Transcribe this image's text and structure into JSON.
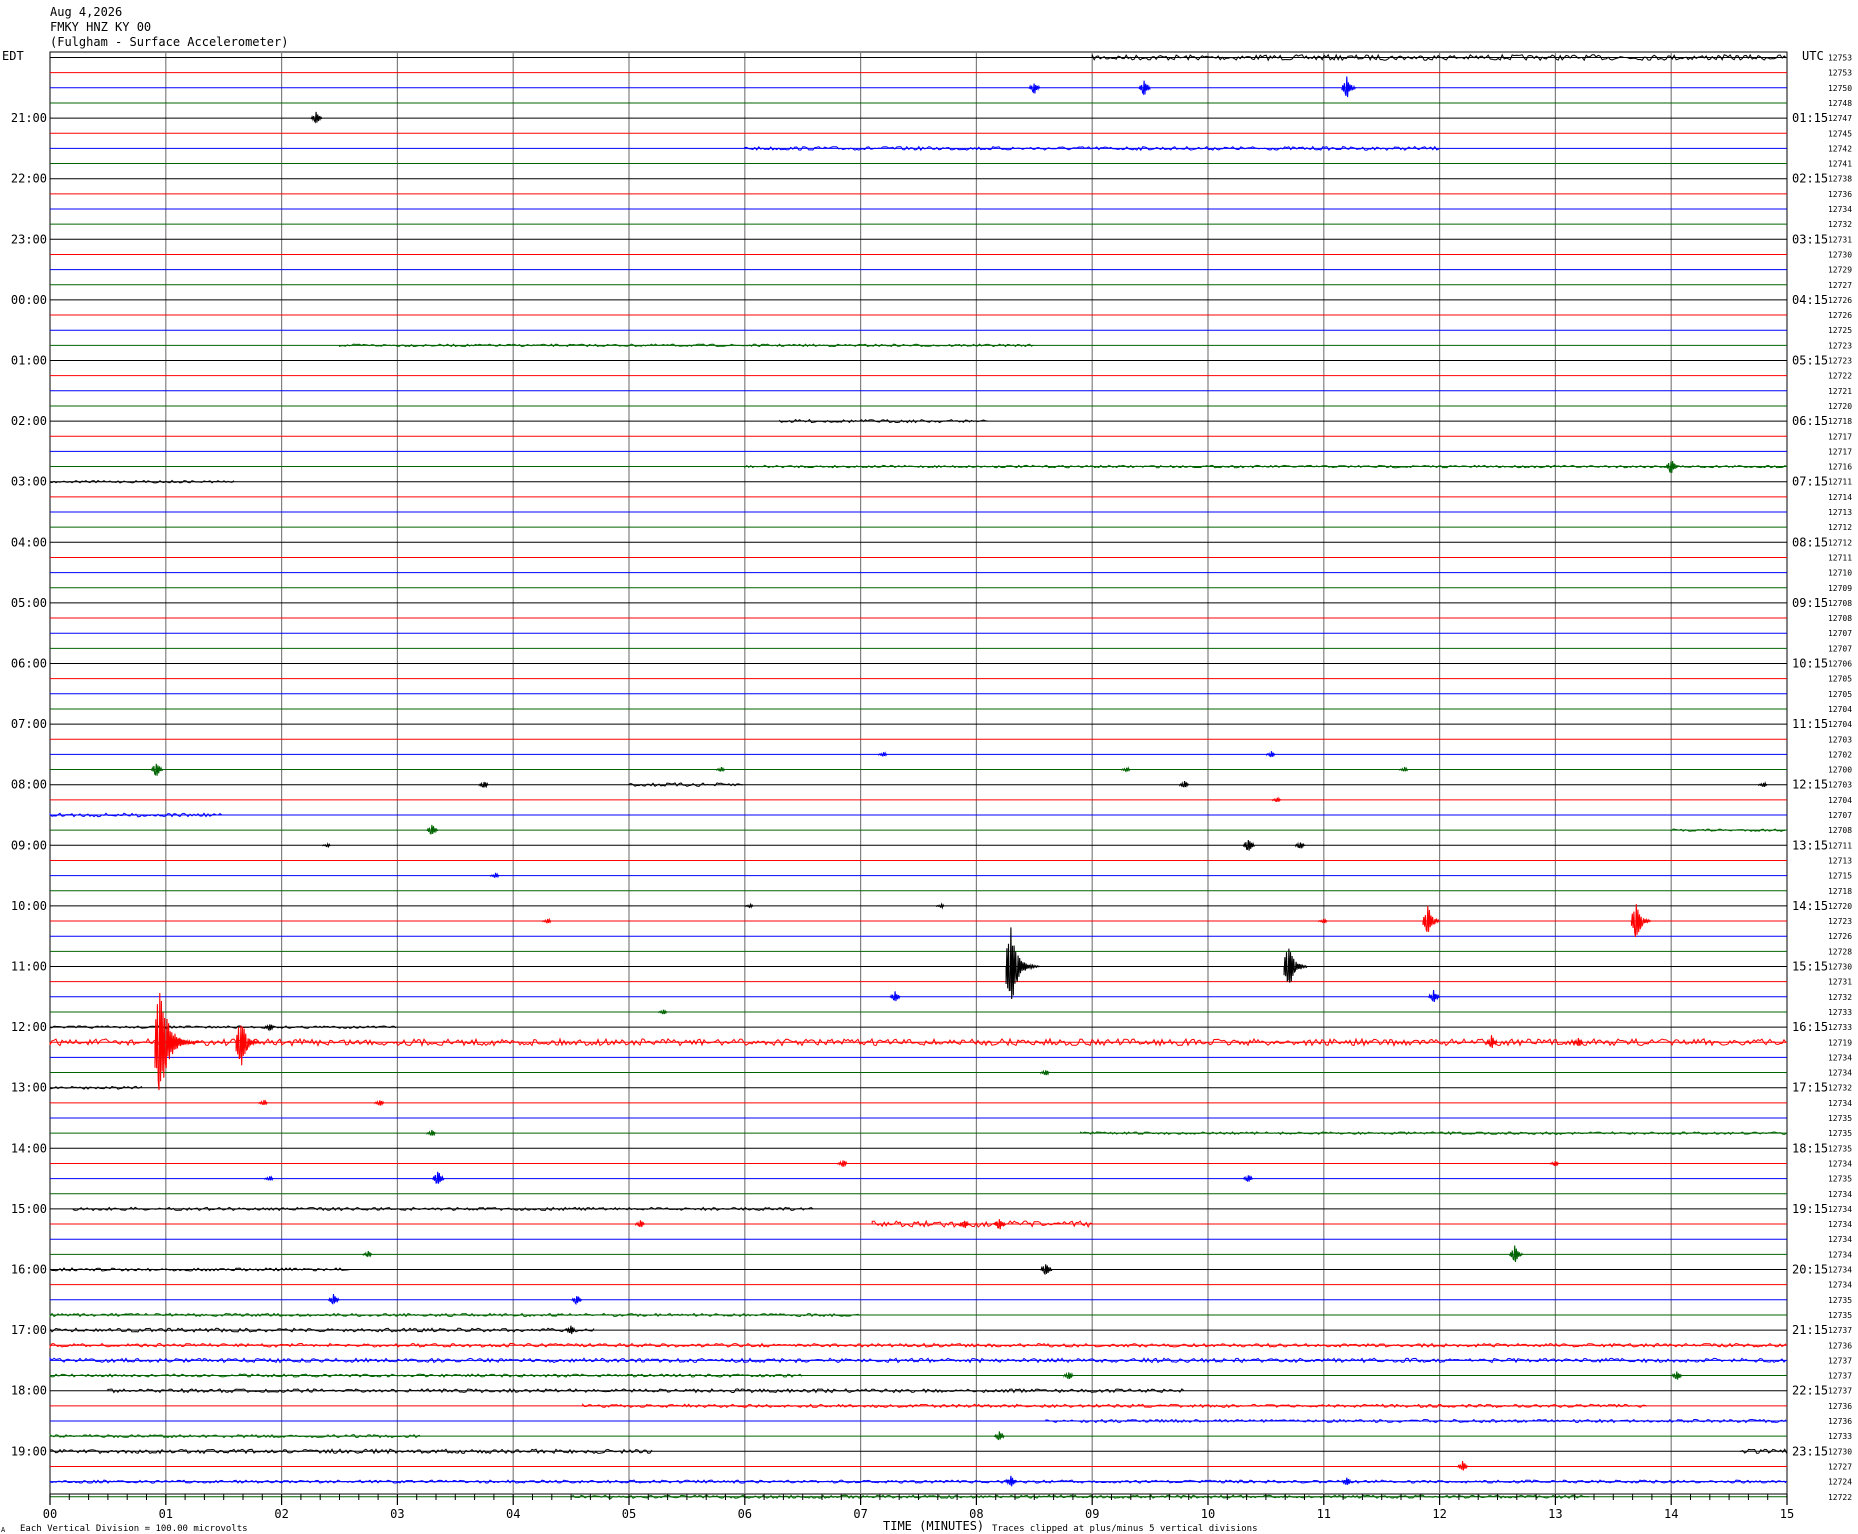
{
  "header": {
    "date": "Aug 4,2026",
    "station": "FMKY HNZ KY 00",
    "description": "(Fulgham - Surface Accelerometer)"
  },
  "footer": {
    "division_note": "Each Vertical Division =  100.00 microvolts",
    "clip_note": "Traces clipped at plus/minus 5 vertical divisions",
    "corner_mark": "A"
  },
  "chart_data": {
    "type": "line",
    "title": "FMKY HNZ KY 00",
    "xlabel": "TIME (MINUTES)",
    "ylabel_left": "EDT",
    "ylabel_right": "UTC",
    "xlim": [
      0,
      15
    ],
    "x_ticks": [
      "00",
      "01",
      "02",
      "03",
      "04",
      "05",
      "06",
      "07",
      "08",
      "09",
      "10",
      "11",
      "12",
      "13",
      "14",
      "15"
    ],
    "grid": true,
    "trace_count": 96,
    "trace_minutes": 15,
    "series_colors": [
      "#000000",
      "#ff0000",
      "#0000ff",
      "#006400"
    ],
    "grid_color": "#808080",
    "left_hour_labels": [
      "21:00",
      "22:00",
      "23:00",
      "00:00",
      "01:00",
      "02:00",
      "03:00",
      "04:00",
      "05:00",
      "06:00",
      "07:00",
      "08:00",
      "09:00",
      "10:00",
      "11:00",
      "12:00",
      "13:00",
      "14:00",
      "15:00",
      "16:00",
      "17:00",
      "18:00",
      "19:00"
    ],
    "right_hour_labels": [
      "01:15",
      "02:15",
      "03:15",
      "04:15",
      "05:15",
      "06:15",
      "07:15",
      "08:15",
      "09:15",
      "10:15",
      "11:15",
      "12:15",
      "13:15",
      "14:15",
      "15:15",
      "16:15",
      "17:15",
      "18:15",
      "19:15",
      "20:15",
      "21:15",
      "22:15",
      "23:15"
    ],
    "first_hour_trace_index": 4,
    "trace_values": [
      "12753",
      "12753",
      "12750",
      "12748",
      "12747",
      "12745",
      "12742",
      "12741",
      "12738",
      "12736",
      "12734",
      "12732",
      "12731",
      "12730",
      "12729",
      "12727",
      "12726",
      "12726",
      "12725",
      "12723",
      "12723",
      "12722",
      "12721",
      "12720",
      "12718",
      "12717",
      "12717",
      "12716",
      "12711",
      "12714",
      "12713",
      "12712",
      "12712",
      "12711",
      "12710",
      "12709",
      "12708",
      "12708",
      "12707",
      "12707",
      "12706",
      "12705",
      "12705",
      "12704",
      "12704",
      "12703",
      "12702",
      "12700",
      "12703",
      "12704",
      "12707",
      "12708",
      "12711",
      "12713",
      "12715",
      "12718",
      "12720",
      "12723",
      "12726",
      "12728",
      "12730",
      "12731",
      "12732",
      "12733",
      "12733",
      "12719",
      "12734",
      "12734",
      "12732",
      "12734",
      "12735",
      "12735",
      "12735",
      "12734",
      "12735",
      "12734",
      "12734",
      "12734",
      "12734",
      "12734",
      "12734",
      "12734",
      "12735",
      "12735",
      "12737",
      "12736",
      "12737",
      "12737",
      "12737",
      "12736",
      "12736",
      "12733",
      "12730",
      "12727",
      "12724",
      "12722"
    ],
    "events": [
      {
        "trace": 2,
        "minute": 8.5,
        "amp": 0.5
      },
      {
        "trace": 2,
        "minute": 9.45,
        "amp": 0.6
      },
      {
        "trace": 2,
        "minute": 11.2,
        "amp": 0.8
      },
      {
        "trace": 4,
        "minute": 2.3,
        "amp": 0.45
      },
      {
        "trace": 27,
        "minute": 14.0,
        "amp": 0.6
      },
      {
        "trace": 46,
        "minute": 7.2,
        "amp": 0.2
      },
      {
        "trace": 46,
        "minute": 10.55,
        "amp": 0.25
      },
      {
        "trace": 47,
        "minute": 0.92,
        "amp": 0.6
      },
      {
        "trace": 47,
        "minute": 5.8,
        "amp": 0.2
      },
      {
        "trace": 47,
        "minute": 9.3,
        "amp": 0.2
      },
      {
        "trace": 47,
        "minute": 11.7,
        "amp": 0.2
      },
      {
        "trace": 48,
        "minute": 3.75,
        "amp": 0.3
      },
      {
        "trace": 48,
        "minute": 9.8,
        "amp": 0.3
      },
      {
        "trace": 48,
        "minute": 14.8,
        "amp": 0.2
      },
      {
        "trace": 49,
        "minute": 10.6,
        "amp": 0.2
      },
      {
        "trace": 51,
        "minute": 3.3,
        "amp": 0.5
      },
      {
        "trace": 52,
        "minute": 2.4,
        "amp": 0.15
      },
      {
        "trace": 52,
        "minute": 10.35,
        "amp": 0.55
      },
      {
        "trace": 52,
        "minute": 10.8,
        "amp": 0.3
      },
      {
        "trace": 54,
        "minute": 3.85,
        "amp": 0.2
      },
      {
        "trace": 56,
        "minute": 6.05,
        "amp": 0.15
      },
      {
        "trace": 56,
        "minute": 7.7,
        "amp": 0.15
      },
      {
        "trace": 57,
        "minute": 4.3,
        "amp": 0.2
      },
      {
        "trace": 57,
        "minute": 11.0,
        "amp": 0.2
      },
      {
        "trace": 57,
        "minute": 11.9,
        "amp": 1.1
      },
      {
        "trace": 57,
        "minute": 13.7,
        "amp": 1.4
      },
      {
        "trace": 60,
        "minute": 8.3,
        "amp": 2.8
      },
      {
        "trace": 60,
        "minute": 10.7,
        "amp": 1.8
      },
      {
        "trace": 62,
        "minute": 7.3,
        "amp": 0.4
      },
      {
        "trace": 62,
        "minute": 11.95,
        "amp": 0.5
      },
      {
        "trace": 63,
        "minute": 5.3,
        "amp": 0.2
      },
      {
        "trace": 64,
        "minute": 1.9,
        "amp": 0.3
      },
      {
        "trace": 65,
        "minute": 0.95,
        "amp": 3.9
      },
      {
        "trace": 65,
        "minute": 1.65,
        "amp": 1.8
      },
      {
        "trace": 65,
        "minute": 12.45,
        "amp": 0.5
      },
      {
        "trace": 65,
        "minute": 13.2,
        "amp": 0.35
      },
      {
        "trace": 67,
        "minute": 8.6,
        "amp": 0.25
      },
      {
        "trace": 69,
        "minute": 1.85,
        "amp": 0.25
      },
      {
        "trace": 69,
        "minute": 2.85,
        "amp": 0.3
      },
      {
        "trace": 71,
        "minute": 3.3,
        "amp": 0.25
      },
      {
        "trace": 73,
        "minute": 6.85,
        "amp": 0.3
      },
      {
        "trace": 73,
        "minute": 13.0,
        "amp": 0.25
      },
      {
        "trace": 74,
        "minute": 1.9,
        "amp": 0.2
      },
      {
        "trace": 74,
        "minute": 3.35,
        "amp": 0.6
      },
      {
        "trace": 74,
        "minute": 10.35,
        "amp": 0.35
      },
      {
        "trace": 77,
        "minute": 5.1,
        "amp": 0.3
      },
      {
        "trace": 77,
        "minute": 8.2,
        "amp": 0.5
      },
      {
        "trace": 77,
        "minute": 7.9,
        "amp": 0.35
      },
      {
        "trace": 79,
        "minute": 2.75,
        "amp": 0.25
      },
      {
        "trace": 79,
        "minute": 12.65,
        "amp": 0.7
      },
      {
        "trace": 80,
        "minute": 8.6,
        "amp": 0.55
      },
      {
        "trace": 82,
        "minute": 2.45,
        "amp": 0.5
      },
      {
        "trace": 82,
        "minute": 4.55,
        "amp": 0.4
      },
      {
        "trace": 84,
        "minute": 4.5,
        "amp": 0.35
      },
      {
        "trace": 87,
        "minute": 8.8,
        "amp": 0.35
      },
      {
        "trace": 87,
        "minute": 14.05,
        "amp": 0.4
      },
      {
        "trace": 91,
        "minute": 8.2,
        "amp": 0.4
      },
      {
        "trace": 93,
        "minute": 12.2,
        "amp": 0.4
      },
      {
        "trace": 94,
        "minute": 8.3,
        "amp": 0.45
      },
      {
        "trace": 94,
        "minute": 11.2,
        "amp": 0.35
      }
    ],
    "noise_segments": [
      {
        "trace": 0,
        "start": 9.0,
        "end": 15.0,
        "amp": 0.18
      },
      {
        "trace": 6,
        "start": 6.0,
        "end": 12.0,
        "amp": 0.12
      },
      {
        "trace": 19,
        "start": 2.5,
        "end": 8.5,
        "amp": 0.08
      },
      {
        "trace": 24,
        "start": 6.3,
        "end": 8.1,
        "amp": 0.1
      },
      {
        "trace": 27,
        "start": 6.0,
        "end": 15.0,
        "amp": 0.08
      },
      {
        "trace": 28,
        "start": 0.0,
        "end": 1.6,
        "amp": 0.08
      },
      {
        "trace": 48,
        "start": 5.0,
        "end": 6.0,
        "amp": 0.12
      },
      {
        "trace": 50,
        "start": 0.0,
        "end": 1.5,
        "amp": 0.12
      },
      {
        "trace": 51,
        "start": 14.0,
        "end": 15.0,
        "amp": 0.08
      },
      {
        "trace": 64,
        "start": 0.0,
        "end": 3.0,
        "amp": 0.08
      },
      {
        "trace": 65,
        "start": 0.0,
        "end": 15.0,
        "amp": 0.22
      },
      {
        "trace": 68,
        "start": 0.0,
        "end": 0.8,
        "amp": 0.1
      },
      {
        "trace": 71,
        "start": 8.9,
        "end": 15.0,
        "amp": 0.08
      },
      {
        "trace": 76,
        "start": 0.2,
        "end": 6.6,
        "amp": 0.1
      },
      {
        "trace": 77,
        "start": 7.1,
        "end": 9.0,
        "amp": 0.2
      },
      {
        "trace": 80,
        "start": 0.0,
        "end": 2.6,
        "amp": 0.1
      },
      {
        "trace": 83,
        "start": 0.0,
        "end": 7.0,
        "amp": 0.1
      },
      {
        "trace": 84,
        "start": 0.0,
        "end": 4.7,
        "amp": 0.12
      },
      {
        "trace": 85,
        "start": 0.0,
        "end": 15.0,
        "amp": 0.12
      },
      {
        "trace": 86,
        "start": 0.0,
        "end": 15.0,
        "amp": 0.14
      },
      {
        "trace": 87,
        "start": 0.0,
        "end": 6.5,
        "amp": 0.1
      },
      {
        "trace": 88,
        "start": 0.5,
        "end": 9.8,
        "amp": 0.12
      },
      {
        "trace": 89,
        "start": 4.6,
        "end": 13.8,
        "amp": 0.1
      },
      {
        "trace": 90,
        "start": 8.6,
        "end": 15.0,
        "amp": 0.1
      },
      {
        "trace": 91,
        "start": 0.0,
        "end": 3.2,
        "amp": 0.1
      },
      {
        "trace": 92,
        "start": 0.0,
        "end": 5.2,
        "amp": 0.14
      },
      {
        "trace": 92,
        "start": 14.6,
        "end": 15.0,
        "amp": 0.14
      },
      {
        "trace": 94,
        "start": 0.0,
        "end": 15.0,
        "amp": 0.1
      },
      {
        "trace": 95,
        "start": 4.5,
        "end": 13.3,
        "amp": 0.1
      }
    ]
  }
}
